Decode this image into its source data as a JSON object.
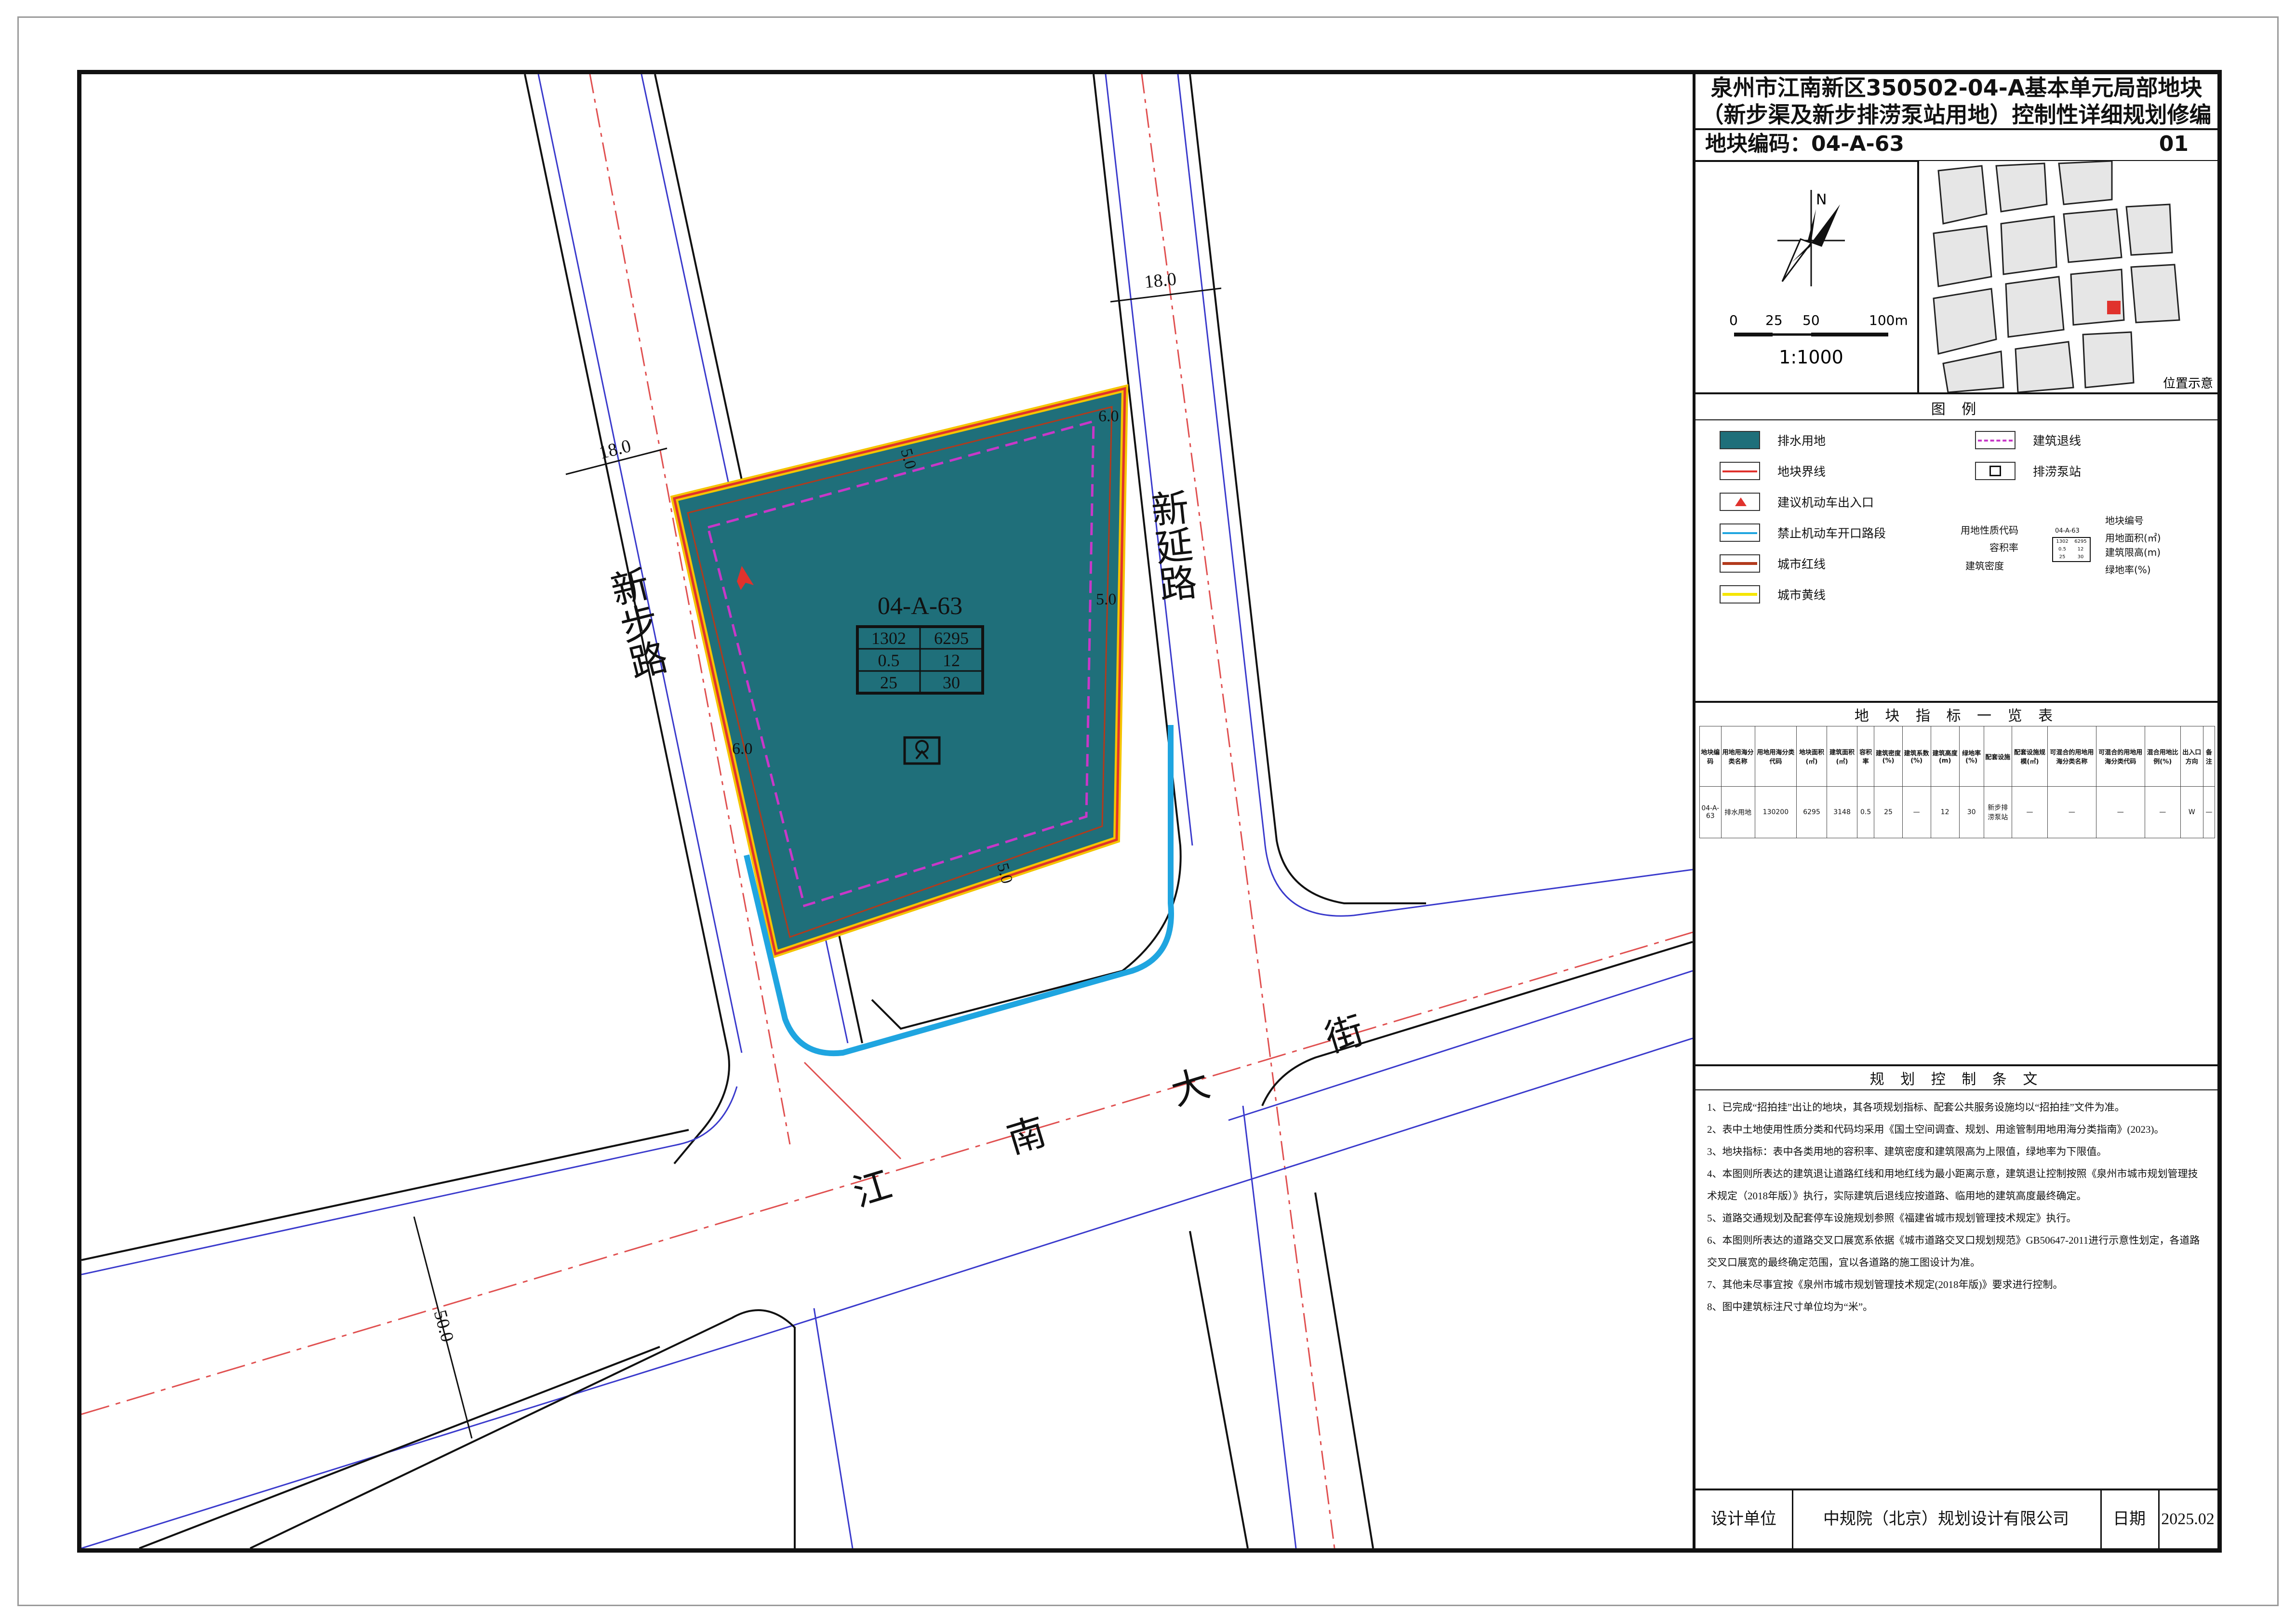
{
  "title": {
    "line1": "泉州市江南新区350502-04-A基本单元局部地块",
    "line2": "（新步渠及新步排涝泵站用地）控制性详细规划修编"
  },
  "parcel_code_label": "地块编码：04-A-63",
  "sheet_number": "01",
  "north_label": "N",
  "scale": {
    "ticks": [
      "0",
      "25",
      "50",
      "100m"
    ],
    "ratio": "1:1000"
  },
  "location_label": "位置示意",
  "legend": {
    "heading": "图    例",
    "items": [
      {
        "label": "排水用地",
        "color": "#1f6f7a",
        "kind": "fill"
      },
      {
        "label": "地块界线",
        "color": "#e0322d",
        "kind": "line"
      },
      {
        "label": "建议机动车出入口",
        "color": "#e0322d",
        "kind": "arrow"
      },
      {
        "label": "禁止机动车开口路段",
        "color": "#1fa5e0",
        "kind": "line"
      },
      {
        "label": "城市红线",
        "color": "#b23a1c",
        "kind": "line"
      },
      {
        "label": "城市黄线",
        "color": "#f5e600",
        "kind": "line"
      },
      {
        "label": "建筑退线",
        "color": "#c838c8",
        "kind": "dash"
      },
      {
        "label": "排涝泵站",
        "color": "#111111",
        "kind": "icon"
      }
    ],
    "key_labels": {
      "land_use_code": "用地性质代码",
      "far": "容积率",
      "density": "建筑密度",
      "parcel_no": "地块编号",
      "area": "用地面积(㎡)",
      "height": "建筑限高(m)",
      "green": "绿地率(%)",
      "sample_code": "04-A-63",
      "sample_cells": [
        "1302",
        "6295",
        "0.5",
        "12",
        "25",
        "30"
      ]
    }
  },
  "index_table": {
    "heading": "地 块 指 标 一 览 表",
    "headers": [
      "地块编码",
      "用地用海分类名称",
      "用地用海分类代码",
      "地块面积(㎡)",
      "建筑面积(㎡)",
      "容积率",
      "建筑密度(%)",
      "建筑系数(%)",
      "建筑高度(m)",
      "绿地率(%)",
      "配套设施",
      "配套设施规模(㎡)",
      "可混合的用地用海分类名称",
      "可混合的用地用海分类代码",
      "混合用地比例(%)",
      "出入口方向",
      "备注"
    ],
    "rows": [
      [
        "04-A-63",
        "排水用地",
        "130200",
        "6295",
        "3148",
        "0.5",
        "25",
        "—",
        "12",
        "30",
        "新步排涝泵站",
        "—",
        "—",
        "—",
        "—",
        "W",
        "—"
      ]
    ]
  },
  "clauses": {
    "heading": "规 划 控 制 条 文",
    "items": [
      "1、已完成“招拍挂”出让的地块，其各项规划指标、配套公共服务设施均以“招拍挂”文件为准。",
      "2、表中土地使用性质分类和代码均采用《国土空间调查、规划、用途管制用地用海分类指南》(2023)。",
      "3、地块指标：表中各类用地的容积率、建筑密度和建筑限高为上限值，绿地率为下限值。",
      "4、本图则所表达的建筑退让道路红线和用地红线为最小距离示意，建筑退让控制按照《泉州市城市规划管理技术规定（2018年版）》执行，实际建筑后退线应按道路、临用地的建筑高度最终确定。",
      "5、道路交通规划及配套停车设施规划参照《福建省城市规划管理技术规定》执行。",
      "6、本图则所表达的道路交叉口展宽系依据《城市道路交叉口规划规范》GB50647-2011进行示意性划定，各道路交叉口展宽的最终确定范围，宜以各道路的施工图设计为准。",
      "7、其他未尽事宜按《泉州市城市规划管理技术规定(2018年版)》要求进行控制。",
      "8、图中建筑标注尺寸单位均为“米”。"
    ]
  },
  "footer": {
    "designer_label": "设计单位",
    "designer": "中规院（北京）规划设计有限公司",
    "date_label": "日期",
    "date": "2025.02"
  },
  "map": {
    "roads": {
      "xinbu": "新步路",
      "xinyan": "新延路",
      "jiangnan": [
        "江",
        "南",
        "大",
        "街"
      ]
    },
    "widths": {
      "xinbu": "18.0",
      "xinyan": "18.0",
      "jiangnan": "50.0"
    },
    "setbacks": [
      "5.0",
      "6.0",
      "5.0",
      "6.0",
      "5.0"
    ],
    "parcel": {
      "code": "04-A-63",
      "cells": [
        "1302",
        "6295",
        "0.5",
        "12",
        "25",
        "30"
      ]
    },
    "colors": {
      "parcel_fill": "#1f6f7a",
      "red_line": "#e0322d",
      "yellow_line": "#f5c400",
      "no_access": "#1fa5e0",
      "setback": "#c838c8",
      "road_edge": "#3a3acc",
      "centerline": "#e05050"
    }
  }
}
